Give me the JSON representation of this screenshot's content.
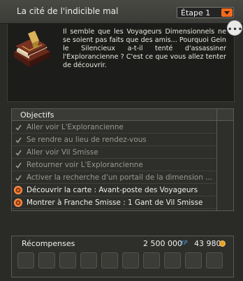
{
  "header": {
    "title": "La cité de l'indicible mal",
    "step_select": {
      "value": "Étape 1"
    }
  },
  "description": {
    "text": "Il semble que les Voyageurs Dimensionnels ne se soient pas faits que des amis... Pourquoi Gein le Silencieux a-t-il tenté d'assassiner l'Explorancienne ? C'est ce que vous allez tenter de découvrir."
  },
  "objectives": {
    "title": "Objectifs",
    "items": [
      {
        "label": "Aller voir L'Explorancienne",
        "state": "done"
      },
      {
        "label": "Se rendre au lieu de rendez-vous",
        "state": "done"
      },
      {
        "label": "Aller voir Vil Smisse",
        "state": "done"
      },
      {
        "label": "Retourner voir L'Explorancienne",
        "state": "done"
      },
      {
        "label": "Activer la recherche d'un portail de la dimension ...",
        "state": "done"
      },
      {
        "label": "Découvrir la carte : Avant-poste des Voyageurs",
        "state": "active"
      },
      {
        "label": "Montrer à Franche Smisse : 1 Gant de Vil Smisse",
        "state": "active"
      }
    ]
  },
  "rewards": {
    "title": "Récompenses",
    "xp": "2 500 000",
    "xp_label": "XP",
    "kamas": "43 980",
    "slot_count": 10
  },
  "colors": {
    "accent": "#f26b1d",
    "done_text": "#9a9a92",
    "active_text": "#f1f1eb",
    "xp": "#5aa0e6"
  },
  "icons": {
    "quest": "book-icon",
    "done": "check-icon",
    "active": "target-icon",
    "currency": "kamas-icon"
  }
}
